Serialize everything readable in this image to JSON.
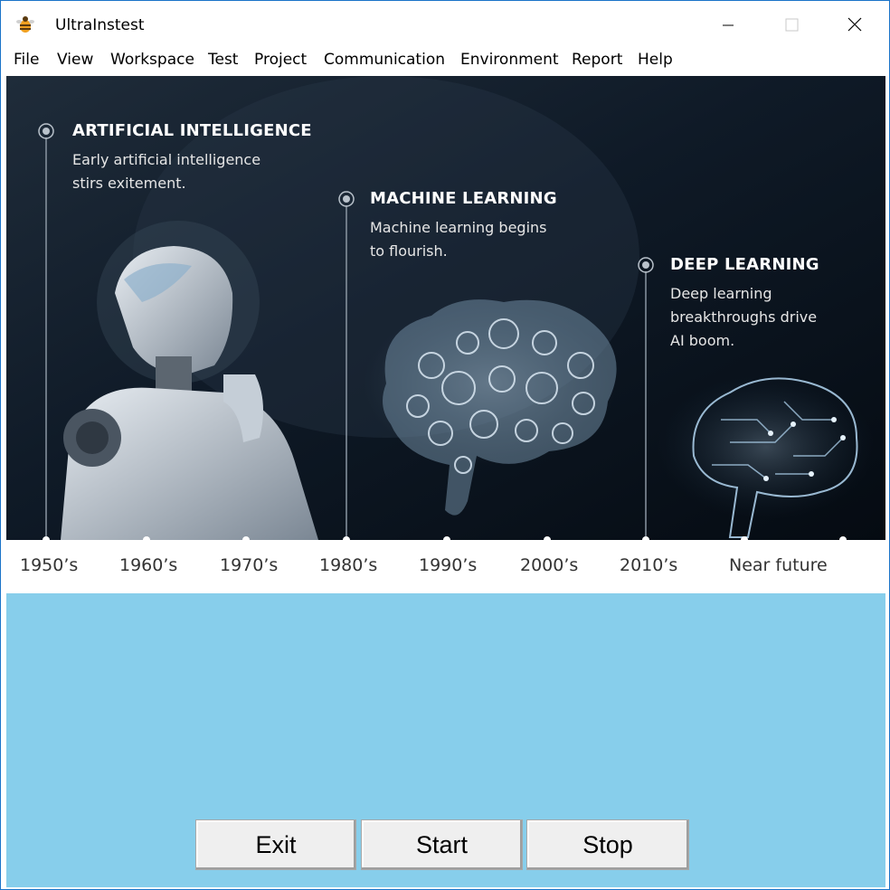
{
  "window": {
    "title": "UltraInstest"
  },
  "menu": {
    "items": [
      "File",
      "View",
      "Workspace",
      "Test",
      "Project",
      "Communication",
      "Environment",
      "Report",
      "Help"
    ]
  },
  "banner": {
    "eras": [
      {
        "heading": "ARTIFICIAL INTELLIGENCE",
        "line1": "Early artificial intelligence",
        "line2": "stirs exitement.",
        "line3": ""
      },
      {
        "heading": "MACHINE LEARNING",
        "line1": "Machine learning begins",
        "line2": "to flourish.",
        "line3": ""
      },
      {
        "heading": "DEEP LEARNING",
        "line1": "Deep learning",
        "line2": "breakthroughs drive",
        "line3": "AI boom."
      }
    ],
    "timeline": [
      "1950’s",
      "1960’s",
      "1970’s",
      "1980’s",
      "1990’s",
      "2000’s",
      "2010’s",
      "Near future"
    ]
  },
  "buttons": {
    "exit": "Exit",
    "start": "Start",
    "stop": "Stop"
  },
  "colors": {
    "content_background": "#87ceeb",
    "banner_dark": "#0b1420",
    "window_border": "#1a73c8"
  }
}
